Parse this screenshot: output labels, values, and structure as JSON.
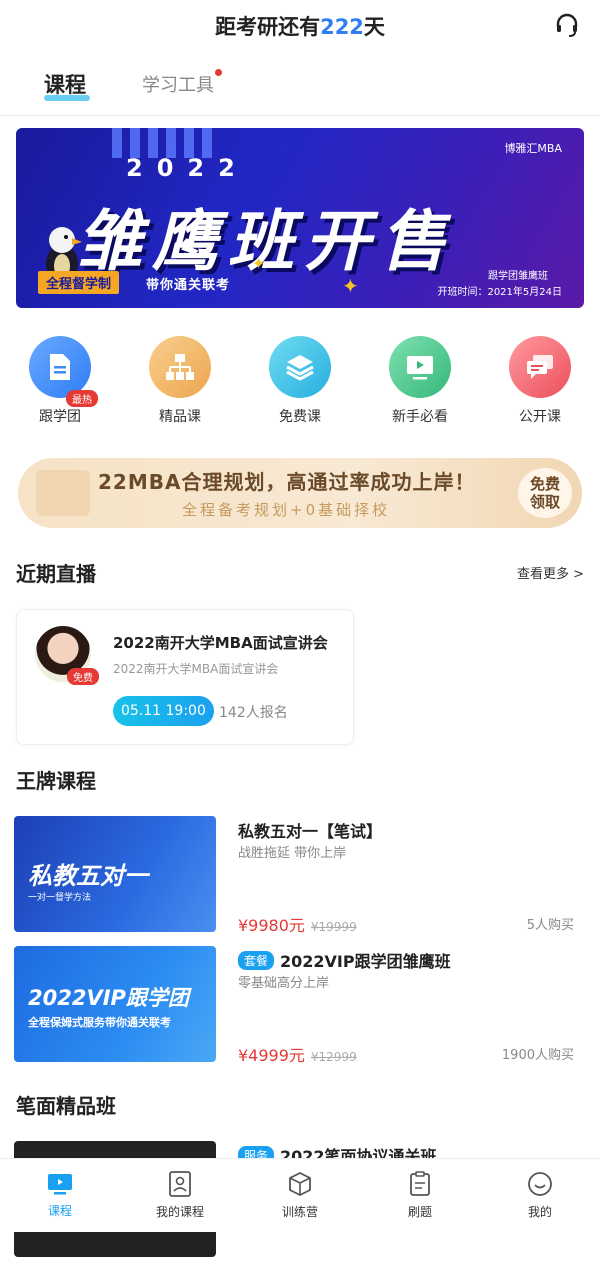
{
  "header": {
    "title_prefix": "距考研还有",
    "days": "222",
    "title_suffix": "天"
  },
  "tabs": [
    {
      "label": "课程",
      "active": true
    },
    {
      "label": "学习工具",
      "active": false,
      "has_dot": true
    }
  ],
  "banner": {
    "brand": "博雅汇MBA",
    "year": "2022",
    "headline": "雏鹰班开售",
    "tag": "全程督学制",
    "tagline": "带你通关联考",
    "info1": "跟学团雏鹰班",
    "info2": "开班时间：2021年5月24日"
  },
  "grid": [
    {
      "label": "跟学团",
      "icon": "document-icon",
      "badge": "最热",
      "color": "#3d8ef7"
    },
    {
      "label": "精品课",
      "icon": "sitemap-icon",
      "color": "#f0b35f"
    },
    {
      "label": "免费课",
      "icon": "layers-icon",
      "color": "#3ac0e0"
    },
    {
      "label": "新手必看",
      "icon": "play-screen-icon",
      "color": "#46c08a"
    },
    {
      "label": "公开课",
      "icon": "chat-icon",
      "color": "#f0606a"
    }
  ],
  "promo": {
    "line1": "22MBA合理规划，高通过率成功上岸！",
    "line2": "全程备考规划+0基础择校",
    "button": "免费领取"
  },
  "live_section": {
    "title": "近期直播",
    "more": "查看更多 >",
    "card": {
      "title": "2022南开大学MBA面试宣讲会",
      "subtitle": "2022南开大学MBA面试宣讲会",
      "badge": "免费",
      "time": "05.11 19:00",
      "count": "142人报名"
    }
  },
  "ace_section": {
    "title": "王牌课程",
    "courses": [
      {
        "title": "私教五对一【笔试】",
        "subtitle": "战胜拖延 带你上岸",
        "price": "¥9980元",
        "original": "¥19999",
        "buyers": "5人购买",
        "thumb_title": "私教五对一",
        "thumb_sub": "一对一督学方法"
      },
      {
        "badge": "套餐",
        "title": "2022VIP跟学团雏鹰班",
        "subtitle": "零基础高分上岸",
        "price": "¥4999元",
        "original": "¥12999",
        "buyers": "1900人购买",
        "thumb_title": "2022VIP跟学团",
        "thumb_sub": "全程保姆式服务带你通关联考"
      }
    ]
  },
  "written_section": {
    "title": "笔面精品班",
    "course": {
      "badge": "服务",
      "title": "2022笔面协议通关班"
    }
  },
  "tabbar": [
    {
      "label": "课程",
      "icon": "tv-icon",
      "active": true
    },
    {
      "label": "我的课程",
      "icon": "profile-card-icon"
    },
    {
      "label": "训练营",
      "icon": "cube-icon"
    },
    {
      "label": "刷题",
      "icon": "notepad-icon"
    },
    {
      "label": "我的",
      "icon": "smile-icon"
    }
  ]
}
